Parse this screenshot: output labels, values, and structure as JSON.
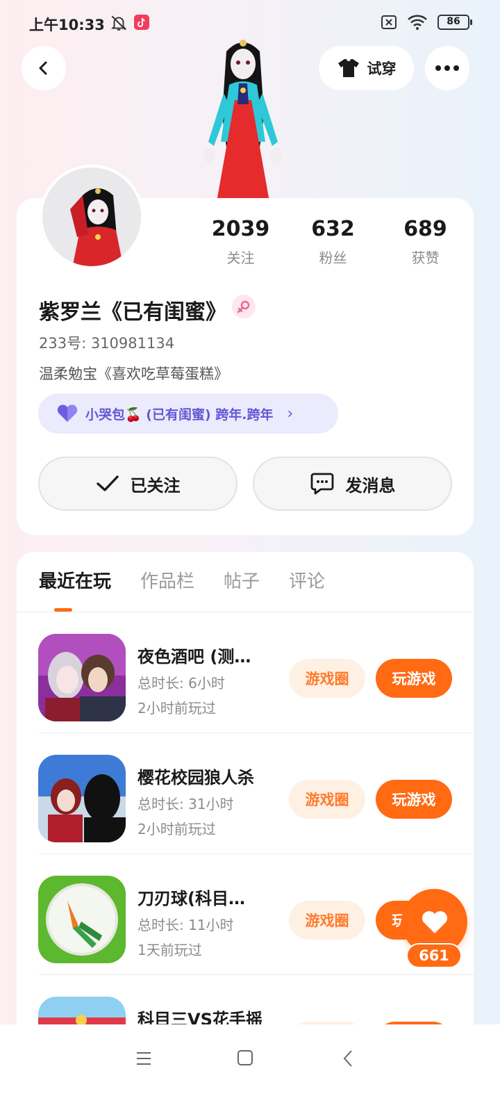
{
  "status_bar": {
    "time": "上午10:33",
    "battery": "86",
    "icons": [
      "mute-bell-icon",
      "tiktok-icon",
      "sim-off-icon",
      "wifi-icon",
      "battery-icon"
    ]
  },
  "header": {
    "try_on_label": "试穿"
  },
  "profile": {
    "stats": [
      {
        "value": "2039",
        "label": "关注"
      },
      {
        "value": "632",
        "label": "粉丝"
      },
      {
        "value": "689",
        "label": "获赞"
      }
    ],
    "nickname": "紫罗兰《已有闺蜜》",
    "gender": "female",
    "user_id": "233号: 310981134",
    "bio": "温柔勉宝《喜欢吃草莓蛋糕》",
    "relation": "小哭包🍒 (已有闺蜜) 跨年.跨年",
    "follow_label": "已关注",
    "message_label": "发消息"
  },
  "tabs": [
    {
      "label": "最近在玩",
      "active": true
    },
    {
      "label": "作品栏",
      "active": false
    },
    {
      "label": "帖子",
      "active": false
    },
    {
      "label": "评论",
      "active": false
    }
  ],
  "games": [
    {
      "name": "夜色酒吧 (测…",
      "duration": "总时长: 6小时",
      "last_played": "2小时前玩过",
      "circle_label": "游戏圈",
      "play_label": "玩游戏"
    },
    {
      "name": "樱花校园狼人杀",
      "duration": "总时长: 31小时",
      "last_played": "2小时前玩过",
      "circle_label": "游戏圈",
      "play_label": "玩游戏"
    },
    {
      "name": "刀刃球(科目…",
      "duration": "总时长: 11小时",
      "last_played": "1天前玩过",
      "circle_label": "游戏圈",
      "play_label": "玩游戏"
    },
    {
      "name": "科目三VS花手摇",
      "duration": "",
      "last_played": "",
      "circle_label": "",
      "play_label": ""
    }
  ],
  "like": {
    "count": "661"
  },
  "colors": {
    "accent": "#ff6a13",
    "relation": "#6358d6"
  }
}
